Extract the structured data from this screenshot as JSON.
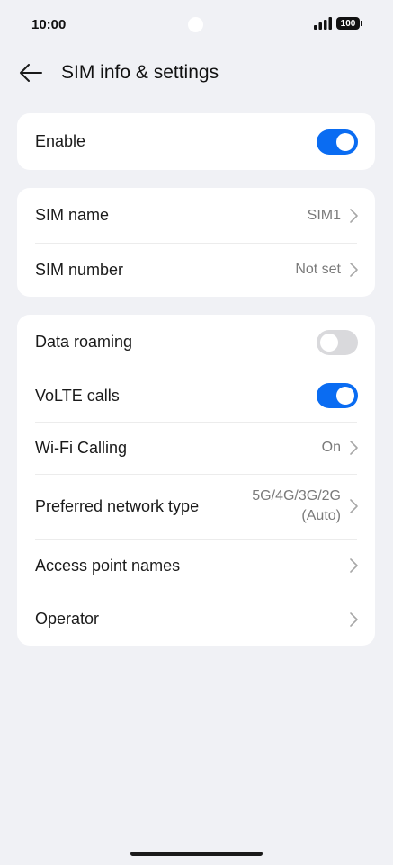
{
  "status_bar": {
    "time": "10:00",
    "battery": "100"
  },
  "header": {
    "title": "SIM info & settings"
  },
  "enable_card": {
    "label": "Enable",
    "toggle_on": true
  },
  "sim_card": {
    "name_label": "SIM name",
    "name_value": "SIM1",
    "number_label": "SIM number",
    "number_value": "Not set"
  },
  "settings_card": {
    "data_roaming_label": "Data roaming",
    "data_roaming_on": false,
    "volte_label": "VoLTE calls",
    "volte_on": true,
    "wifi_calling_label": "Wi-Fi Calling",
    "wifi_calling_value": "On",
    "network_label": "Preferred network type",
    "network_value_line1": "5G/4G/3G/2G",
    "network_value_line2": "(Auto)",
    "apn_label": "Access point names",
    "operator_label": "Operator"
  },
  "colors": {
    "accent": "#0a6cf2",
    "background": "#f0f1f5",
    "card": "#ffffff"
  }
}
